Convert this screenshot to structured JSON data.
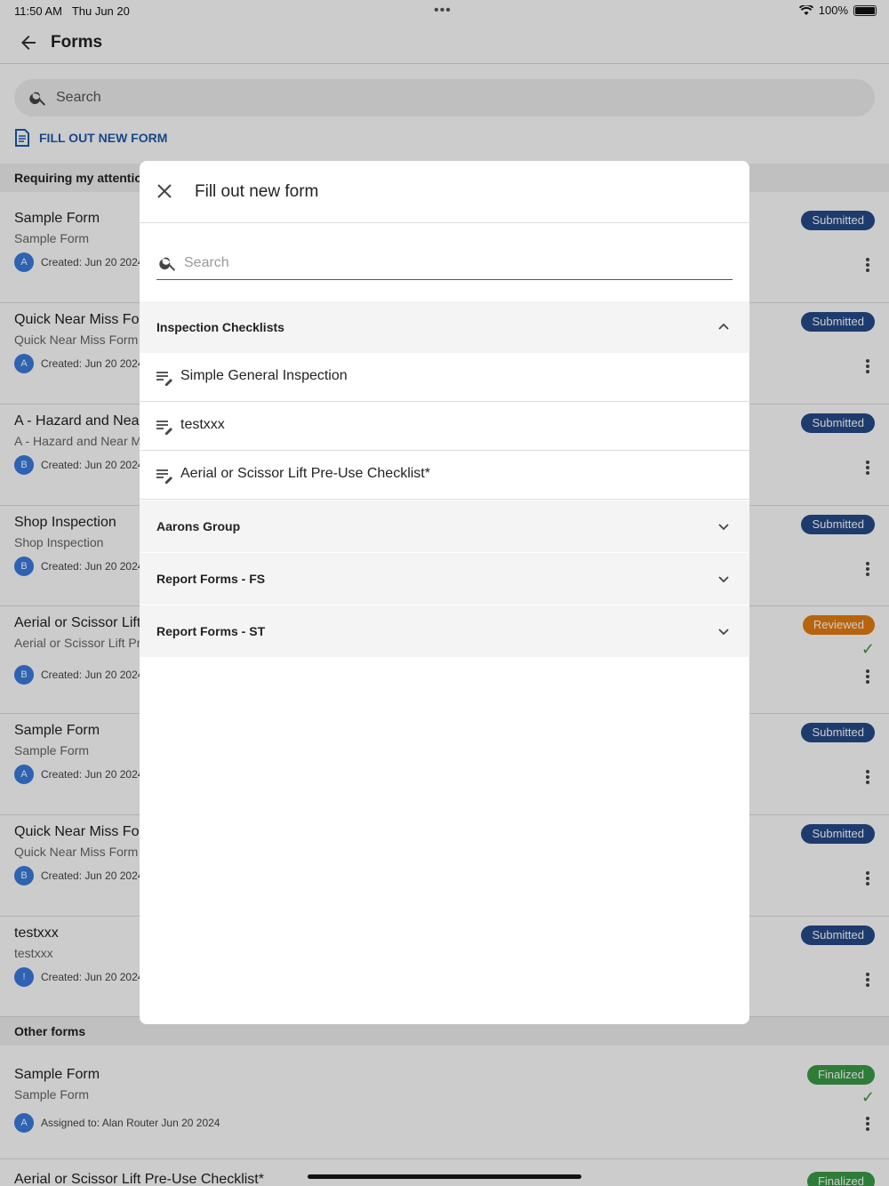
{
  "status_bar": {
    "time": "11:50 AM",
    "date": "Thu Jun 20",
    "battery": "100%"
  },
  "header": {
    "title": "Forms"
  },
  "search": {
    "placeholder": "Search"
  },
  "new_form_link": "FILL OUT NEW FORM",
  "sections": {
    "attention": "Requiring my attention",
    "other": "Other forms"
  },
  "rows": [
    {
      "name": "Sample Form",
      "sub": "Sample Form",
      "avatar": "A",
      "meta": "Created: Jun 20 2024",
      "badge": "Submitted"
    },
    {
      "name": "Quick Near Miss For",
      "sub": "Quick Near Miss Form -",
      "avatar": "A",
      "meta": "Created: Jun 20 2024",
      "badge": "Submitted"
    },
    {
      "name": "A - Hazard and Near",
      "sub": "A - Hazard and Near Mi",
      "avatar": "B",
      "meta": "Created: Jun 20 2024",
      "badge": "Submitted"
    },
    {
      "name": "Shop Inspection",
      "sub": "Shop Inspection",
      "avatar": "B",
      "meta": "Created: Jun 20 2024",
      "badge": "Submitted"
    },
    {
      "name": "Aerial or Scissor Lift",
      "sub": "Aerial or Scissor Lift Pr",
      "avatar": "B",
      "meta": "Created: Jun 20 2024",
      "badge": "Reviewed"
    },
    {
      "name": "Sample Form",
      "sub": "Sample Form",
      "avatar": "A",
      "meta": "Created: Jun 20 2024",
      "badge": "Submitted"
    },
    {
      "name": "Quick Near Miss For",
      "sub": "Quick Near Miss Form -",
      "avatar": "B",
      "meta": "Created: Jun 20 2024",
      "badge": "Submitted"
    },
    {
      "name": "testxxx",
      "sub": "testxxx",
      "avatar": "!",
      "meta": "Created: Jun 20 2024",
      "badge": "Submitted"
    }
  ],
  "other_rows": [
    {
      "name": "Sample Form",
      "sub": "Sample Form",
      "avatar": "A",
      "meta": "Assigned to: Alan Router Jun 20 2024",
      "badge": "Finalized"
    },
    {
      "name": "Aerial or Scissor Lift Pre-Use Checklist*",
      "badge": "Finalized"
    }
  ],
  "modal": {
    "title": "Fill out new form",
    "search_placeholder": "Search",
    "groups": [
      {
        "label": "Inspection Checklists",
        "expanded": true,
        "items": [
          "Simple General Inspection",
          "testxxx",
          "Aerial or Scissor Lift Pre-Use Checklist*"
        ]
      },
      {
        "label": "Aarons Group",
        "expanded": false
      },
      {
        "label": "Report Forms - FS",
        "expanded": false
      },
      {
        "label": "Report Forms - ST",
        "expanded": false
      }
    ]
  },
  "colors": {
    "accent": "#1f5aa8",
    "submitted": "#264a8a",
    "reviewed": "#e67e11",
    "finalized": "#3a9c46",
    "avatar": "#3a7be0"
  }
}
